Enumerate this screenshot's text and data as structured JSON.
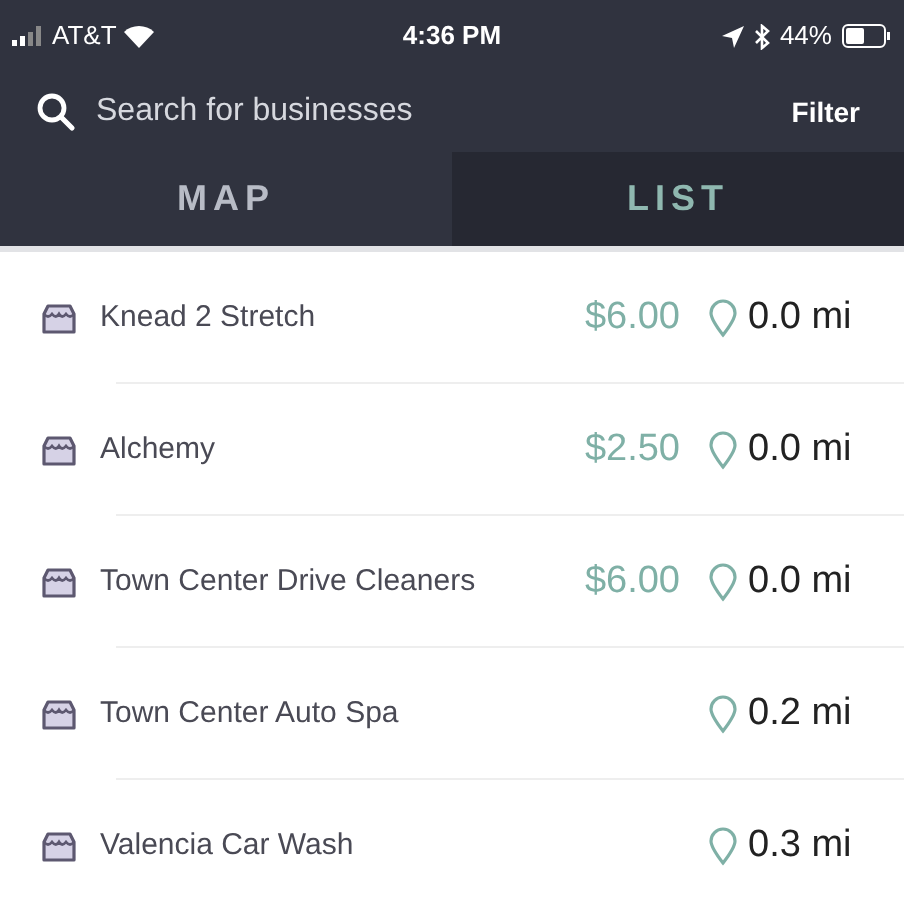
{
  "status_bar": {
    "carrier": "AT&T",
    "time": "4:36 PM",
    "battery": "44%"
  },
  "search": {
    "placeholder": "Search for businesses",
    "filter": "Filter"
  },
  "tabs": [
    {
      "label": "MAP",
      "selected": false
    },
    {
      "label": "LIST",
      "selected": true
    }
  ],
  "businesses": [
    {
      "name": "Knead 2 Stretch",
      "price": "$6.00",
      "distance": "0.0 mi"
    },
    {
      "name": "Alchemy",
      "price": "$2.50",
      "distance": "0.0 mi"
    },
    {
      "name": "Town Center Drive Cleaners",
      "price": "$6.00",
      "distance": "0.0 mi"
    },
    {
      "name": "Town Center Auto Spa",
      "distance": "0.2 mi"
    },
    {
      "name": "Valencia Car Wash",
      "distance": "0.3 mi"
    }
  ]
}
